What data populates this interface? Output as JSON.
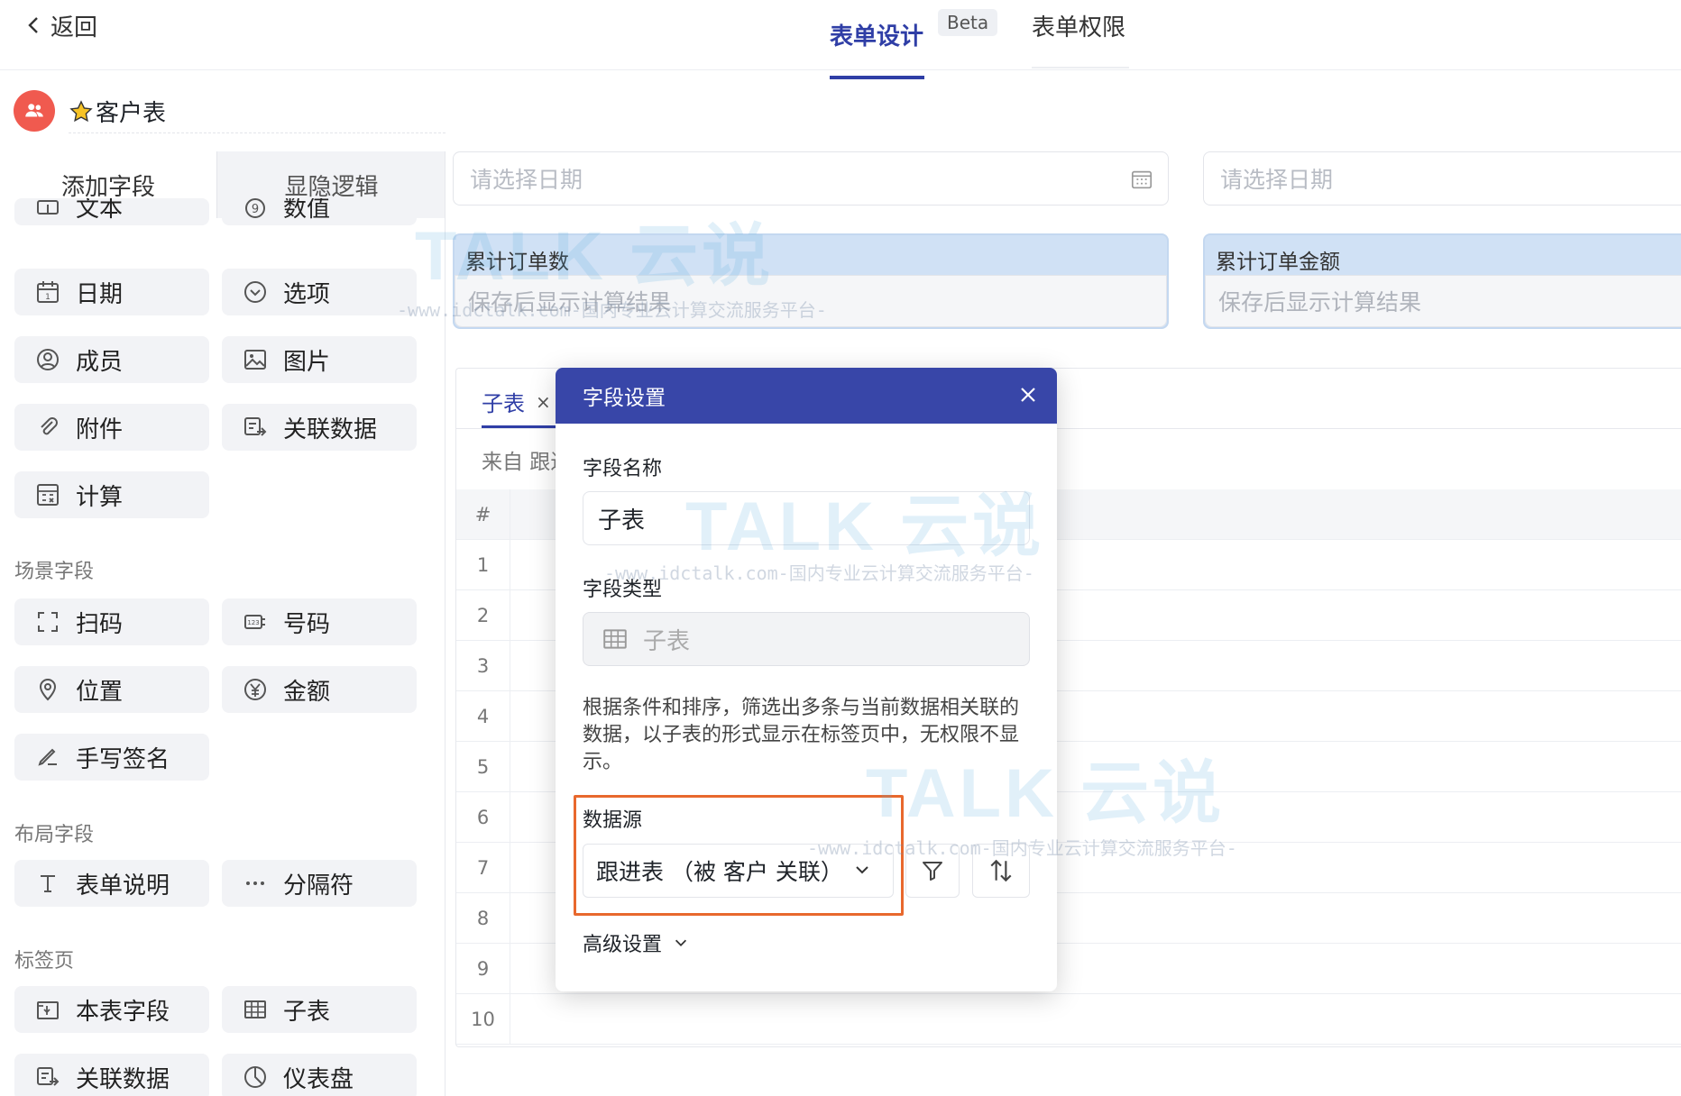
{
  "topbar": {
    "back_label": "返回",
    "tabs": [
      {
        "label": "表单设计",
        "active": true,
        "badge": "Beta"
      },
      {
        "label": "表单权限",
        "active": false
      }
    ]
  },
  "form": {
    "title": "客户表",
    "avatar_icon": "users-icon",
    "title_icon": "star-icon"
  },
  "left_panel": {
    "tabs": [
      "添加字段",
      "显隐逻辑"
    ],
    "basic_fields": [
      {
        "label": "文本",
        "icon": "text-icon"
      },
      {
        "label": "数值",
        "icon": "number-icon"
      },
      {
        "label": "日期",
        "icon": "calendar-icon"
      },
      {
        "label": "选项",
        "icon": "option-icon"
      },
      {
        "label": "成员",
        "icon": "member-icon"
      },
      {
        "label": "图片",
        "icon": "image-icon"
      },
      {
        "label": "附件",
        "icon": "paperclip-icon"
      },
      {
        "label": "关联数据",
        "icon": "link-data-icon"
      },
      {
        "label": "计算",
        "icon": "calculator-icon"
      }
    ],
    "section_scene": "场景字段",
    "scene_fields": [
      {
        "label": "扫码",
        "icon": "scan-icon"
      },
      {
        "label": "号码",
        "icon": "number-badge-icon"
      },
      {
        "label": "位置",
        "icon": "location-icon"
      },
      {
        "label": "金额",
        "icon": "yen-icon"
      },
      {
        "label": "手写签名",
        "icon": "signature-icon"
      }
    ],
    "section_layout": "布局字段",
    "layout_fields": [
      {
        "label": "表单说明",
        "icon": "text-t-icon"
      },
      {
        "label": "分隔符",
        "icon": "ellipsis-icon"
      }
    ],
    "section_tabs": "标签页",
    "tab_fields": [
      {
        "label": "本表字段",
        "icon": "form-field-icon"
      },
      {
        "label": "子表",
        "icon": "table-icon"
      },
      {
        "label": "关联数据",
        "icon": "link-data-icon"
      },
      {
        "label": "仪表盘",
        "icon": "dashboard-icon"
      }
    ]
  },
  "canvas": {
    "date_placeholder_1": "请选择日期",
    "date_placeholder_2": "请选择日期",
    "calc_fields": [
      {
        "label": "累计订单数",
        "placeholder": "保存后显示计算结果"
      },
      {
        "label": "累计订单金额",
        "placeholder": "保存后显示计算结果"
      }
    ],
    "subtable": {
      "tab_label": "子表",
      "tab_close": "×",
      "source_text": "来自 跟进",
      "header_hash": "#",
      "rows": [
        "1",
        "2",
        "3",
        "4",
        "5",
        "6",
        "7",
        "8",
        "9",
        "10"
      ]
    }
  },
  "modal": {
    "title": "字段设置",
    "field_name_label": "字段名称",
    "field_name_value": "子表",
    "field_type_label": "字段类型",
    "field_type_value": "子表",
    "description": "根据条件和排序，筛选出多条与当前数据相关联的数据，以子表的形式显示在标签页中，无权限不显示。",
    "datasource_label": "数据源",
    "datasource_value": "跟进表 （被 客户 关联）",
    "advanced_label": "高级设置",
    "highlight_color": "#e8682d"
  },
  "watermark": {
    "logo": "TALK 云说",
    "url": "-www.idctalk.com-国内专业云计算交流服务平台-"
  },
  "colors": {
    "primary": "#2f3ea6",
    "modal_header": "#3846a8",
    "avatar": "#f05a4f"
  }
}
